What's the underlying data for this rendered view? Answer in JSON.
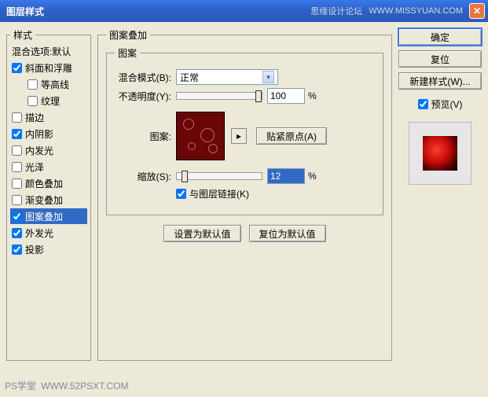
{
  "window": {
    "title": "图层样式",
    "watermark1": "思缘设计论坛",
    "watermark2": "WWW.MISSYUAN.COM"
  },
  "sidebar": {
    "header": "样式",
    "blend_opts": "混合选项:默认",
    "items": [
      {
        "checked": true,
        "label": "斜面和浮雕",
        "indent": false
      },
      {
        "checked": false,
        "label": "等高线",
        "indent": true
      },
      {
        "checked": false,
        "label": "纹理",
        "indent": true
      },
      {
        "checked": false,
        "label": "描边",
        "indent": false
      },
      {
        "checked": true,
        "label": "内阴影",
        "indent": false
      },
      {
        "checked": false,
        "label": "内发光",
        "indent": false
      },
      {
        "checked": false,
        "label": "光泽",
        "indent": false
      },
      {
        "checked": false,
        "label": "颜色叠加",
        "indent": false
      },
      {
        "checked": false,
        "label": "渐变叠加",
        "indent": false
      },
      {
        "checked": true,
        "label": "图案叠加",
        "indent": false,
        "selected": true
      },
      {
        "checked": true,
        "label": "外发光",
        "indent": false
      },
      {
        "checked": true,
        "label": "投影",
        "indent": false
      }
    ]
  },
  "main": {
    "panel_title": "图案叠加",
    "pattern_group": "图案",
    "labels": {
      "blend_mode": "混合模式(B):",
      "opacity": "不透明度(Y):",
      "pattern": "图案:",
      "scale": "缩放(S):",
      "link_layer": "与图层链接(K)"
    },
    "values": {
      "blend_mode": "正常",
      "opacity": "100",
      "scale": "12",
      "link_layer_checked": true
    },
    "unit": "%",
    "snap_origin": "贴紧原点(A)",
    "set_default": "设置为默认值",
    "reset_default": "复位为默认值"
  },
  "right": {
    "ok": "确定",
    "cancel": "复位",
    "new_style": "新建样式(W)...",
    "preview": "预览(V)"
  },
  "footer": {
    "mark1": "PS学堂",
    "mark2": "WWW.52PSXT.COM"
  }
}
